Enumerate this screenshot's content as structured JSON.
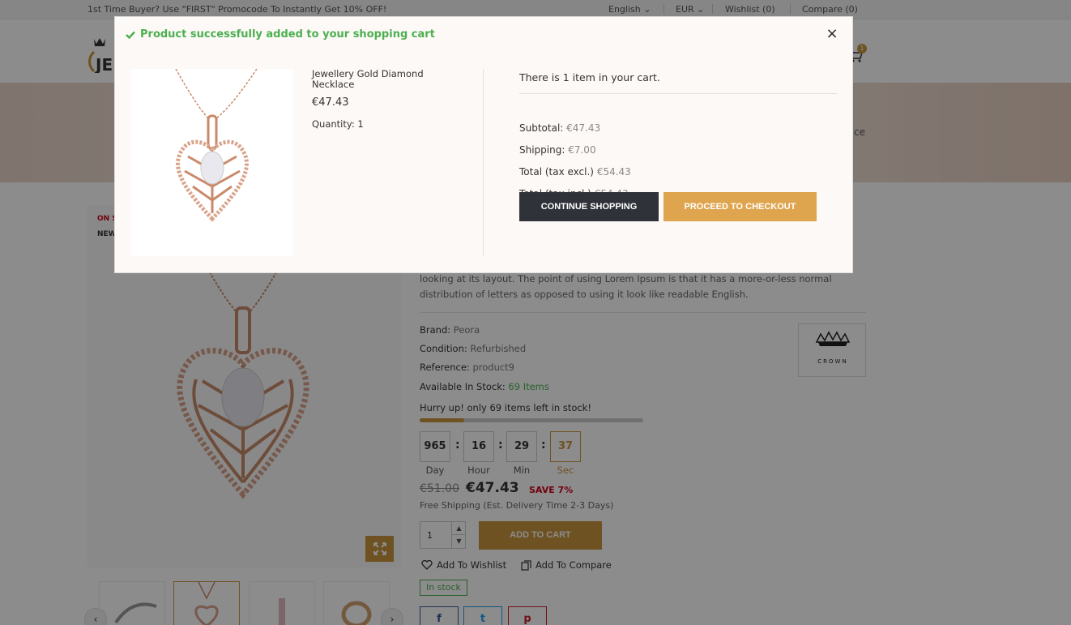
{
  "topbar": {
    "promo": "1st Time Buyer? Use \"FIRST\" Promocode To Instantly Get 10% OFF!",
    "language": "English",
    "currency": "EUR",
    "wishlist": "Wishlist (0)",
    "compare": "Compare (0)"
  },
  "header": {
    "logo_text": "JE",
    "cart_count": "1"
  },
  "banner": {
    "crumb": "ce"
  },
  "product": {
    "flag_sale": "ON S",
    "flag_new": "NEW",
    "description": "looking at its layout. The point of using Lorem Ipsum is that it has a more-or-less normal distribution of letters as opposed to using it look like readable English.",
    "brand_label": "Brand:",
    "brand_value": "Peora",
    "condition_label": "Condition:",
    "condition_value": "Refurbished",
    "reference_label": "Reference:",
    "reference_value": "product9",
    "stock_label": "Available In Stock:",
    "stock_value": "69 Items",
    "brand_logo_text": "CROWN",
    "hurry": "Hurry up! only 69 items left in stock!",
    "stock_fraction": 0.2,
    "countdown": {
      "day": "965",
      "hour": "16",
      "min": "29",
      "sec": "37",
      "day_label": "Day",
      "hour_label": "Hour",
      "min_label": "Min",
      "sec_label": "Sec",
      "colon": ":"
    },
    "old_price": "€51.00",
    "price": "€47.43",
    "save": "SAVE 7%",
    "shipping_note": "Free Shipping (Est. Delivery Time 2-3 Days)",
    "qty_value": "1",
    "add_to_cart": "ADD TO CART",
    "wishlist": "Add To Wishlist",
    "compare": "Add To Compare",
    "in_stock": "In stock",
    "social": [
      "f",
      "t",
      "p"
    ]
  },
  "modal": {
    "title": "Product successfully added to your shopping cart",
    "close": "×",
    "product_name": "Jewellery Gold Diamond Necklace",
    "product_price": "€47.43",
    "quantity": "Quantity: 1",
    "cart_count": "There is 1 item in your cart.",
    "subtotal_label": "Subtotal:",
    "subtotal_value": "€47.43",
    "shipping_label": "Shipping:",
    "shipping_value": "€7.00",
    "total_excl_label": "Total (tax excl.)",
    "total_excl_value": "€54.43",
    "total_incl_label": "Total (tax incl.)",
    "total_incl_value": "€54.43",
    "continue": "CONTINUE SHOPPING",
    "checkout": "PROCEED TO CHECKOUT"
  },
  "colors": {
    "accent": "#c8963e",
    "success": "#4caf50",
    "dark_button": "#2f3238",
    "sale_red": "#d0021b"
  }
}
